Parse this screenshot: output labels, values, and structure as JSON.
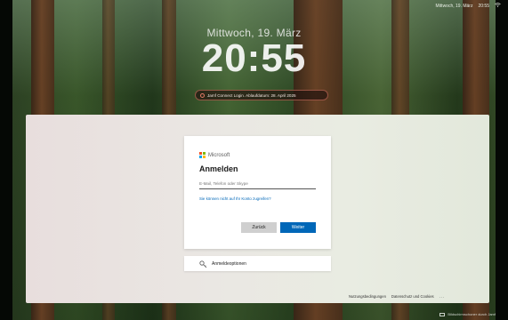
{
  "menubar": {
    "items": [
      "Mittwoch, 19. März",
      "20:55"
    ]
  },
  "lockscreen": {
    "date": "Mittwoch, 19. März",
    "time": "20:55",
    "login_notice": "Jamf Connect Login. Ablaufdatum: 28. April 2025"
  },
  "signin": {
    "brand": "Microsoft",
    "title": "Anmelden",
    "email_placeholder": "E-Mail, Telefon oder Skype",
    "no_access_link": "Sie können nicht auf Ihr Konto zugreifen?",
    "back_button": "Zurück",
    "next_button": "Weiter",
    "options_label": "Anmeldeoptionen"
  },
  "footer": {
    "terms": "Nutzungsbedingungen",
    "privacy": "Datenschutz und Cookies",
    "more": "..."
  },
  "watermark": {
    "text": "Bildschirmschoner durch Jamf"
  },
  "colors": {
    "ms_red": "#f25022",
    "ms_green": "#7fba00",
    "ms_blue": "#00a4ef",
    "ms_yellow": "#ffb900",
    "accent": "#0067b8"
  }
}
